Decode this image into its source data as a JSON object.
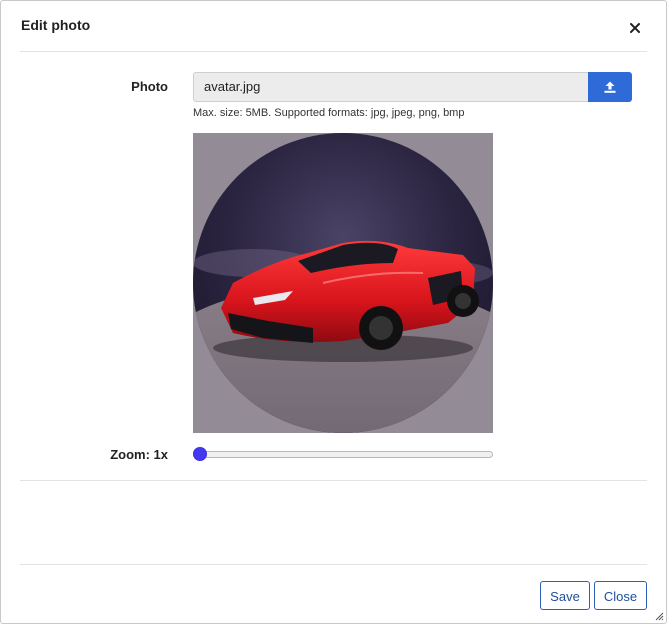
{
  "dialog": {
    "title": "Edit photo",
    "close_icon": "close-icon"
  },
  "photo": {
    "label": "Photo",
    "file_name": "avatar.jpg",
    "upload_icon": "upload-icon",
    "hint": "Max. size: 5MB. Supported formats: jpg, jpeg, png, bmp",
    "preview_description": "red sports car cropped to circle"
  },
  "zoom": {
    "label": "Zoom: 1x",
    "value": 1,
    "fill_fraction": 0.0
  },
  "footer": {
    "save_label": "Save",
    "close_label": "Close"
  },
  "colors": {
    "primary": "#2f6ad9",
    "slider_thumb": "#4438f0",
    "button_border": "#2f5fb0"
  }
}
